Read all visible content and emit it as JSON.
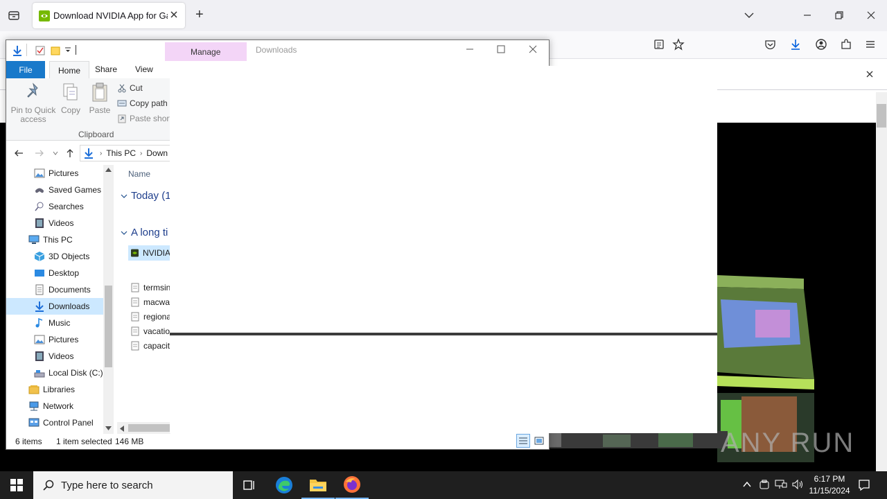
{
  "browser": {
    "tab_title": "Download NVIDIA App for Gam",
    "new_tab_symbol": "+"
  },
  "explorer": {
    "title": "Downloads",
    "context_tab": "Manage",
    "ribbon_tabs": [
      "File",
      "Home",
      "Share",
      "View"
    ],
    "clipboard": {
      "pin_label_1": "Pin to Quick",
      "pin_label_2": "access",
      "copy": "Copy",
      "paste": "Paste",
      "cut": "Cut",
      "copy_path": "Copy path",
      "paste_shortcut": "Paste short",
      "group_label": "Clipboard"
    },
    "address": {
      "crumb_1": "This PC",
      "crumb_2": "Down"
    },
    "nav_items": [
      {
        "label": "Pictures",
        "icon": "pictures-icon"
      },
      {
        "label": "Saved Games",
        "icon": "saved-games-icon"
      },
      {
        "label": "Searches",
        "icon": "searches-icon"
      },
      {
        "label": "Videos",
        "icon": "videos-icon"
      },
      {
        "label": "This PC",
        "icon": "this-pc-icon"
      },
      {
        "label": "3D Objects",
        "icon": "3d-objects-icon"
      },
      {
        "label": "Desktop",
        "icon": "desktop-icon"
      },
      {
        "label": "Documents",
        "icon": "documents-icon"
      },
      {
        "label": "Downloads",
        "icon": "downloads-icon",
        "selected": true
      },
      {
        "label": "Music",
        "icon": "music-icon"
      },
      {
        "label": "Pictures",
        "icon": "pictures-icon"
      },
      {
        "label": "Videos",
        "icon": "videos-icon"
      },
      {
        "label": "Local Disk (C:)",
        "icon": "local-disk-icon"
      },
      {
        "label": "Libraries",
        "icon": "libraries-icon"
      },
      {
        "label": "Network",
        "icon": "network-icon"
      },
      {
        "label": "Control Panel",
        "icon": "control-panel-icon"
      }
    ],
    "file_list": {
      "column_name": "Name",
      "group_today": "Today (1",
      "group_long": "A long ti",
      "today_files": [
        "NVIDIA"
      ],
      "old_files": [
        "termsin",
        "macwa",
        "regiona",
        "vacatio",
        "capacit"
      ]
    },
    "status": {
      "items": "6 items",
      "selected": "1 item selected",
      "size": "146 MB"
    }
  },
  "taskbar": {
    "search_placeholder": "Type here to search",
    "time": "6:17 PM",
    "date": "11/15/2024"
  },
  "watermark": "ANY RUN"
}
